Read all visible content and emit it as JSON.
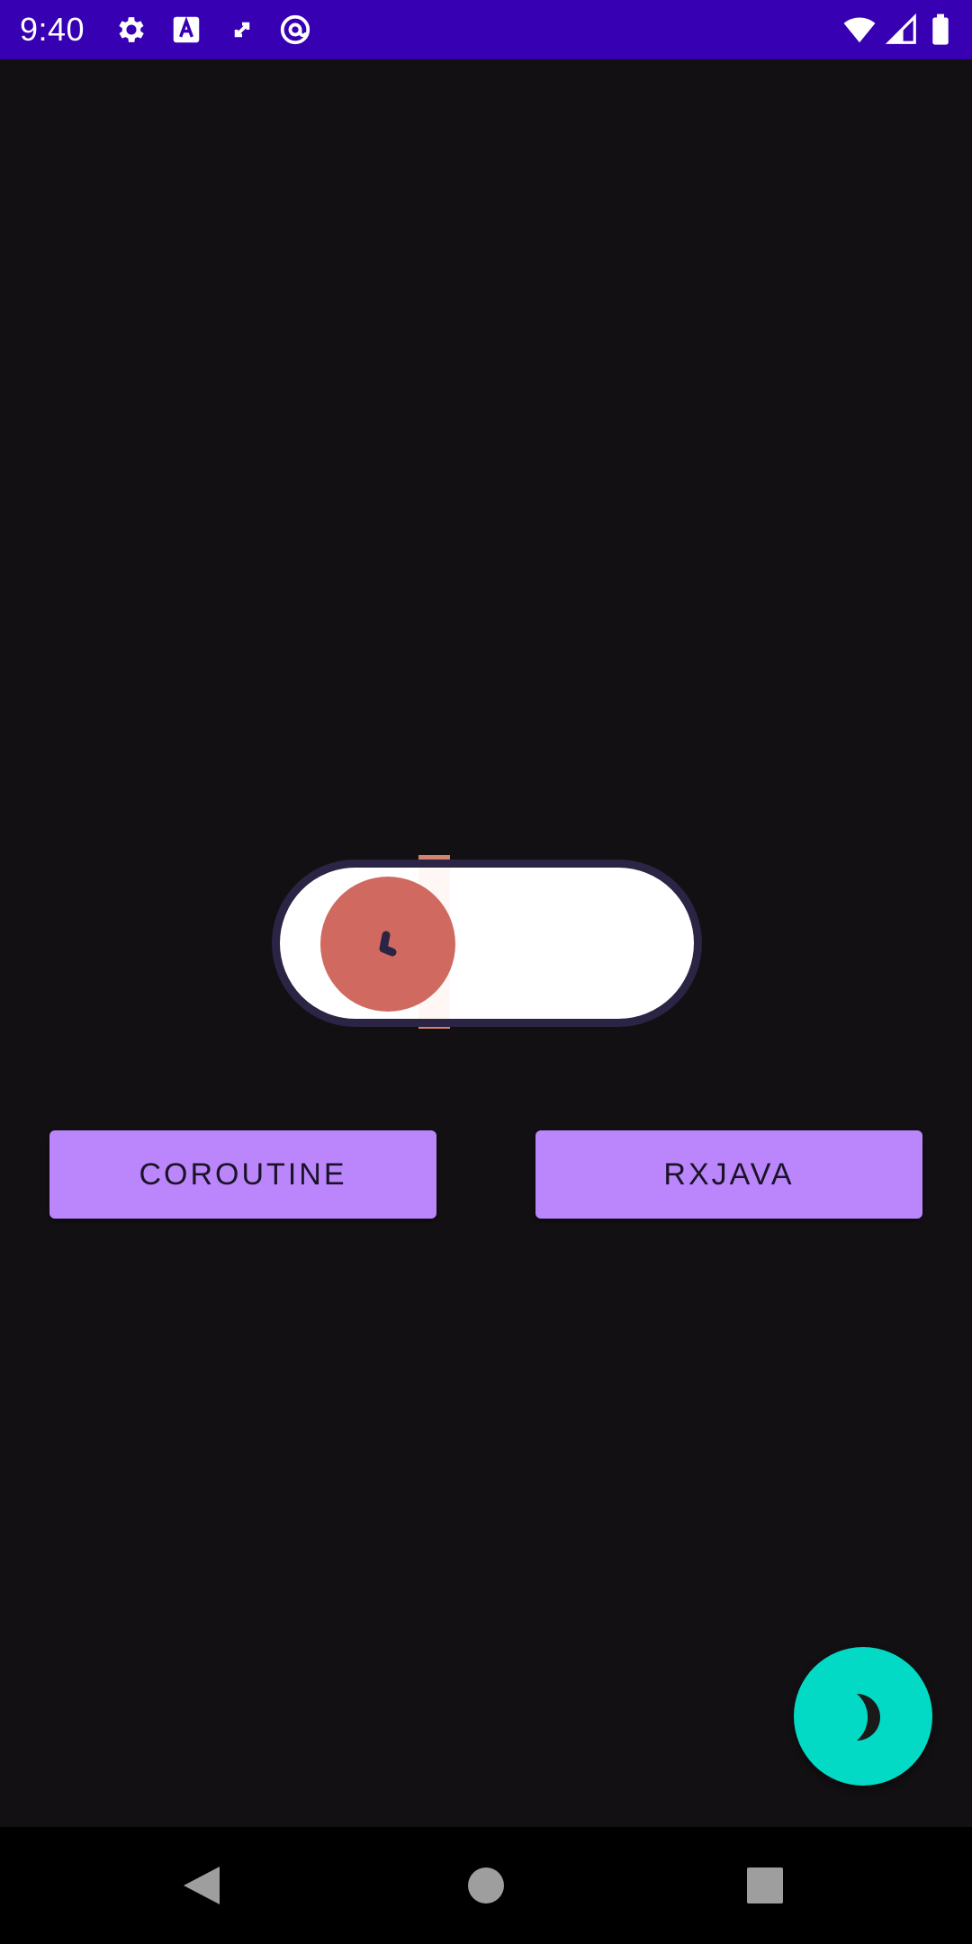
{
  "status_bar": {
    "time": "9:40",
    "background_color": "#3700b3",
    "left_icons": [
      "settings-icon",
      "a-letter-icon",
      "sync-arrows-icon",
      "at-sign-icon"
    ],
    "right_icons": [
      "wifi-icon",
      "cell-signal-icon",
      "battery-icon"
    ]
  },
  "toggle": {
    "state": "off",
    "track_color": "#ffffff",
    "thumb_color": "#d0695f",
    "icon": "clock-hands-icon"
  },
  "buttons": {
    "coroutine_label": "COROUTINE",
    "rxjava_label": "RXJAVA",
    "color": "#bb86fc"
  },
  "fab": {
    "icon": "moon-icon",
    "color": "#03dac5"
  },
  "nav_bar": {
    "icons": [
      "back-triangle-icon",
      "home-circle-icon",
      "recents-square-icon"
    ]
  },
  "theme": {
    "background": "#121013"
  }
}
